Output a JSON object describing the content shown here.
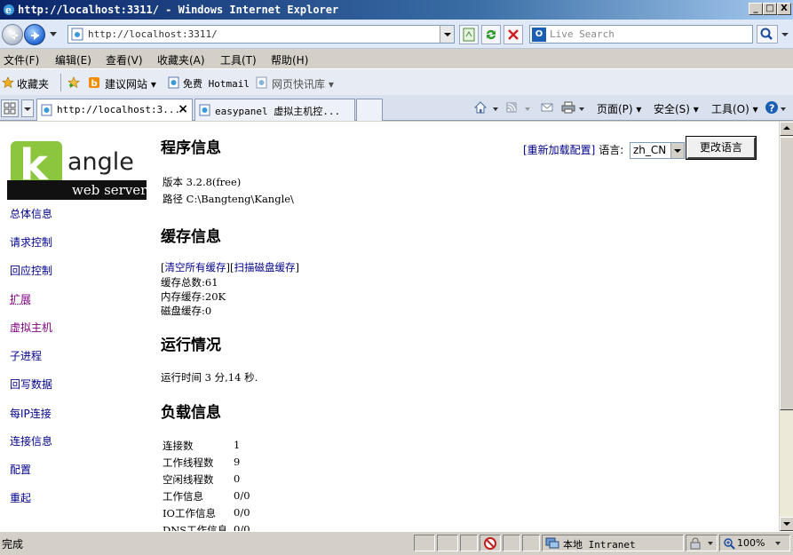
{
  "window": {
    "title": "http://localhost:3311/ - Windows Internet Explorer",
    "minimize": "_",
    "maximize": "□",
    "close": "X"
  },
  "address": {
    "url": "http://localhost:3311/",
    "search_placeholder": "Live Search"
  },
  "menu": [
    "文件(F)",
    "编辑(E)",
    "查看(V)",
    "收藏夹(A)",
    "工具(T)",
    "帮助(H)"
  ],
  "favorites": {
    "label": "收藏夹",
    "items": [
      "建议网站 ▾",
      "免费 Hotmail",
      "网页快讯库 ▾"
    ]
  },
  "tabs": [
    {
      "label": "http://localhost:3...",
      "close": "×"
    },
    {
      "label": "easypanel 虚拟主机控..."
    }
  ],
  "commands": [
    "页面(P) ▾",
    "安全(S) ▾",
    "工具(O) ▾"
  ],
  "logo": {
    "word": "angle",
    "letter": "k",
    "tagline": "web server"
  },
  "nav": [
    "总体信息",
    "请求控制",
    "回应控制",
    "扩展",
    "虚拟主机",
    "子进程",
    "回写数据",
    "每IP连接",
    "连接信息",
    "配置",
    "重起"
  ],
  "lang": {
    "reload": "[重新加载配置]",
    "label": "语言:",
    "value": "zh_CN",
    "button": "更改语言"
  },
  "program": {
    "title": "程序信息",
    "version": "版本 3.2.8(free)",
    "path": "路径 C:\\Bangteng\\Kangle\\"
  },
  "cache": {
    "title": "缓存信息",
    "clear_all": "清空所有缓存",
    "scan_disk": "扫描磁盘缓存",
    "total": "缓存总数:61",
    "memory": "内存缓存:20K",
    "disk": "磁盘缓存:0"
  },
  "runtime": {
    "title": "运行情况",
    "uptime": "运行时间  3 分,14 秒."
  },
  "load": {
    "title": "负载信息",
    "rows": [
      {
        "label": "连接数",
        "value": "1"
      },
      {
        "label": "工作线程数",
        "value": "9"
      },
      {
        "label": "空闲线程数",
        "value": "0"
      },
      {
        "label": "工作信息",
        "value": "0/0"
      },
      {
        "label": "IO工作信息",
        "value": "0/0"
      },
      {
        "label": "DNS工作信息",
        "value": "0/0"
      }
    ]
  },
  "status": {
    "text": "完成",
    "zone": "本地 Intranet",
    "zoom": "100%"
  }
}
